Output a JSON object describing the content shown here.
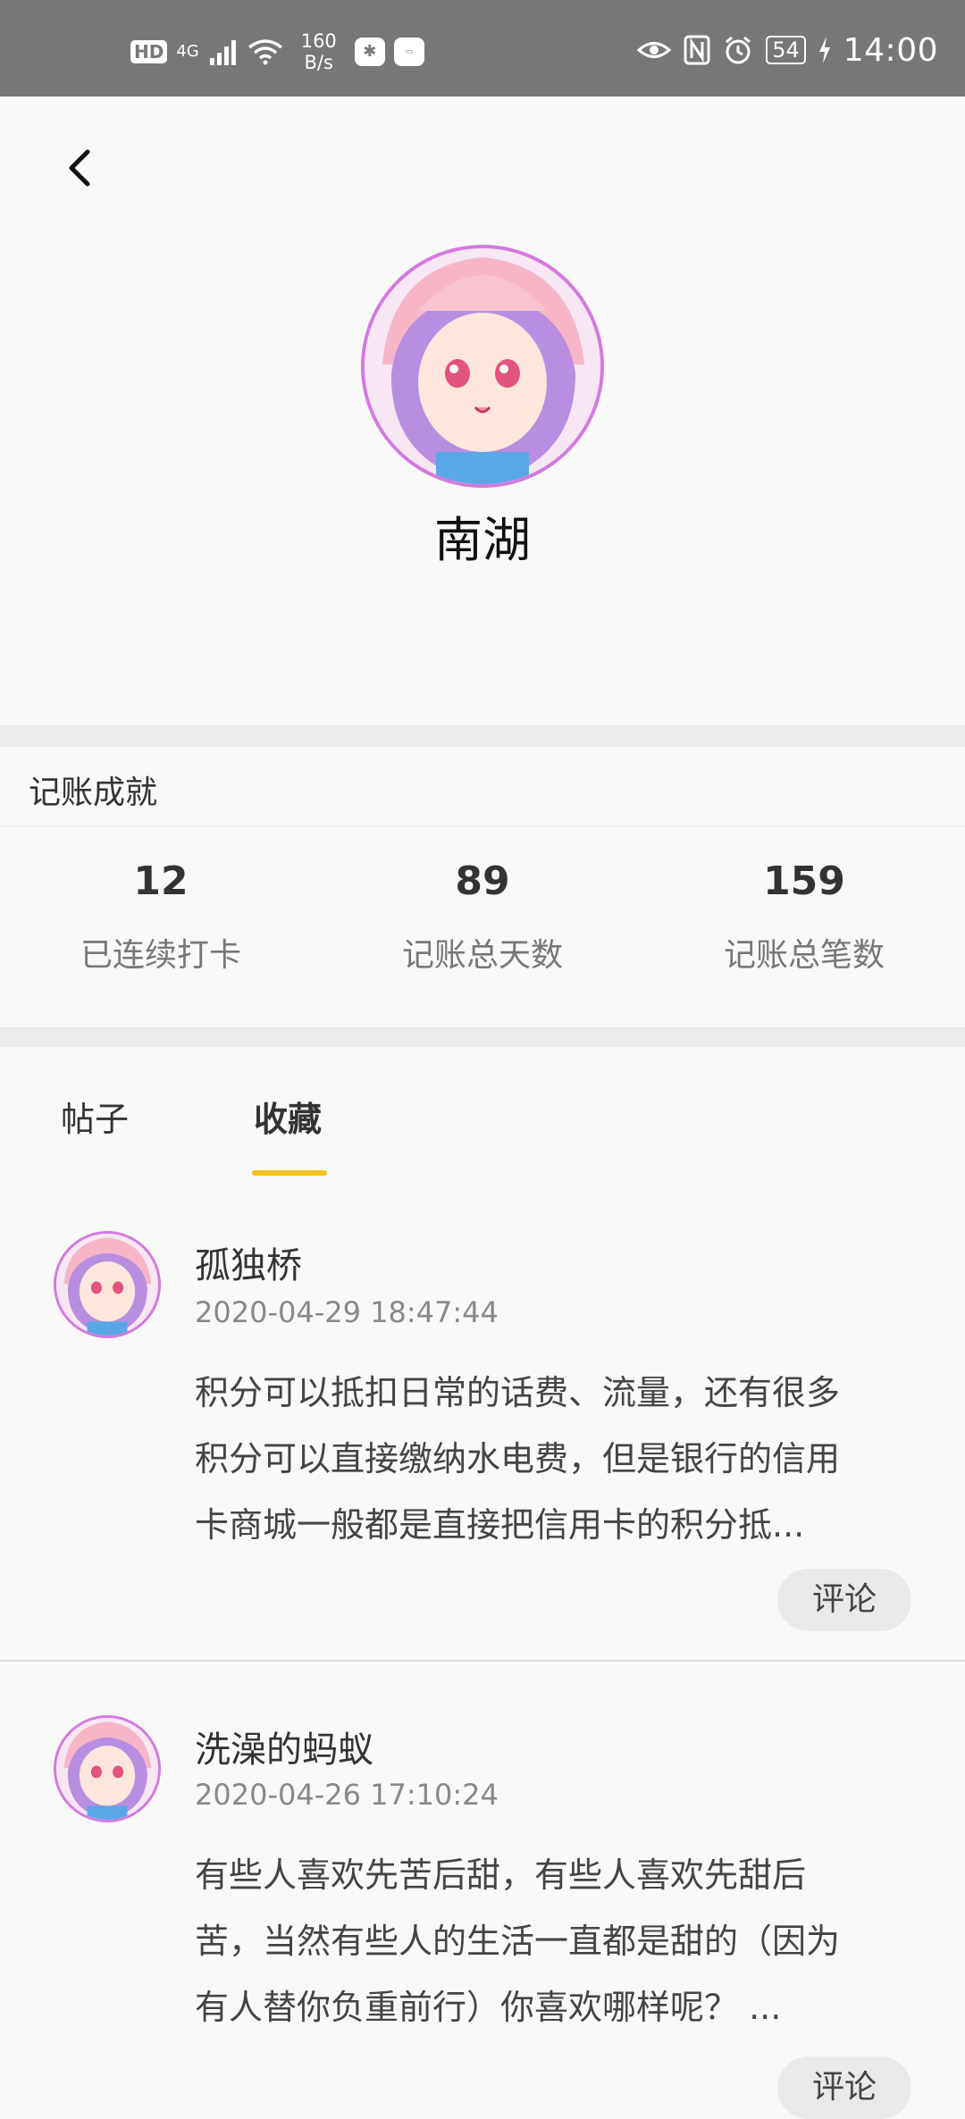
{
  "status_bar": {
    "left": {
      "hd": "HD",
      "network": "4G",
      "speed_value": "160",
      "speed_unit": "B/s"
    },
    "battery": "54",
    "time": "14:00"
  },
  "profile": {
    "name": "南湖"
  },
  "achievements": {
    "title": "记账成就",
    "stats": [
      {
        "value": "12",
        "label": "已连续打卡"
      },
      {
        "value": "89",
        "label": "记账总天数"
      },
      {
        "value": "159",
        "label": "记账总笔数"
      }
    ]
  },
  "tabs": [
    {
      "label": "帖子",
      "active": false
    },
    {
      "label": "收藏",
      "active": true
    }
  ],
  "posts": [
    {
      "author": "孤独桥",
      "time": "2020-04-29 18:47:44",
      "lines": [
        "积分可以抵扣日常的话费、流量，还有很多",
        "积分可以直接缴纳水电费，但是银行的信用",
        "卡商城一般都是直接把信用卡的积分抵..."
      ],
      "comment_label": "评论"
    },
    {
      "author": "洗澡的蚂蚁",
      "time": "2020-04-26 17:10:24",
      "lines": [
        "有些人喜欢先苦后甜，有些人喜欢先甜后",
        "苦，当然有些人的生活一直都是甜的（因为",
        "有人替你负重前行）你喜欢哪样呢？ ..."
      ],
      "comment_label": "评论"
    }
  ],
  "colors": {
    "status_bar_bg": "#777777",
    "tab_indicator": "#f5c21b",
    "avatar_border": "#d27adf",
    "section_gap": "#ececec"
  }
}
